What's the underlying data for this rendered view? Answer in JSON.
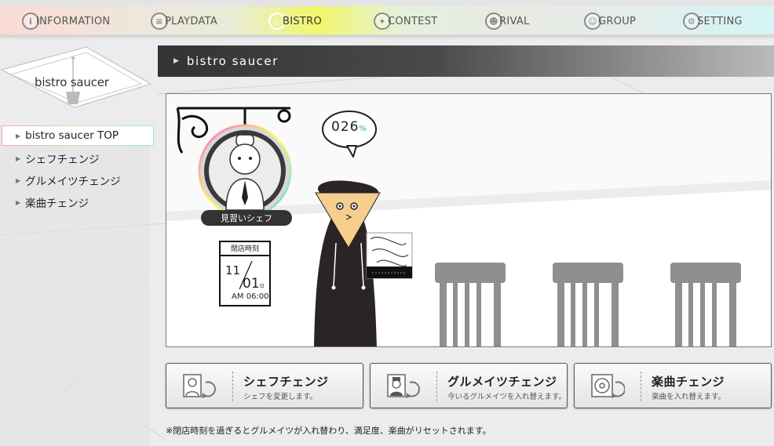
{
  "nav": {
    "items": [
      {
        "label": "INFORMATION",
        "icon": "info-icon"
      },
      {
        "label": "PLAYDATA",
        "icon": "playdata-icon"
      },
      {
        "label": "BISTRO",
        "icon": "bistro-icon"
      },
      {
        "label": "CONTEST",
        "icon": "contest-icon"
      },
      {
        "label": "RIVAL",
        "icon": "rival-icon"
      },
      {
        "label": "GROUP",
        "icon": "group-icon"
      },
      {
        "label": "SETTING",
        "icon": "setting-icon"
      }
    ]
  },
  "sidebar": {
    "logo": "bistro saucer",
    "items": [
      {
        "label": "bistro saucer TOP"
      },
      {
        "label": "シェフチェンジ"
      },
      {
        "label": "グルメイツチェンジ"
      },
      {
        "label": "楽曲チェンジ"
      }
    ]
  },
  "page": {
    "title": "bistro saucer"
  },
  "scene": {
    "chef_rank": "見習いシェフ",
    "satisfaction": "026",
    "satisfaction_unit": "%",
    "calendar": {
      "header": "閉店時刻",
      "month": "11",
      "day": "01",
      "day_suffix": "日",
      "time": "AM 06:00"
    }
  },
  "actions": [
    {
      "title": "シェフチェンジ",
      "sub": "シェフを変更します。",
      "icon": "chef-change-icon"
    },
    {
      "title": "グルメイツチェンジ",
      "sub": "今いるグルメイツを入れ替えます。",
      "icon": "gourmate-change-icon"
    },
    {
      "title": "楽曲チェンジ",
      "sub": "楽曲を入れ替えます。",
      "icon": "song-change-icon"
    }
  ],
  "note": "※閉店時刻を過ぎるとグルメイツが入れ替わり、満足度、楽曲がリセットされます。",
  "colors": {
    "title_bar": "#333333",
    "accent_percent": "#2fa7c4",
    "bistro_highlight": "#f2f76a"
  }
}
